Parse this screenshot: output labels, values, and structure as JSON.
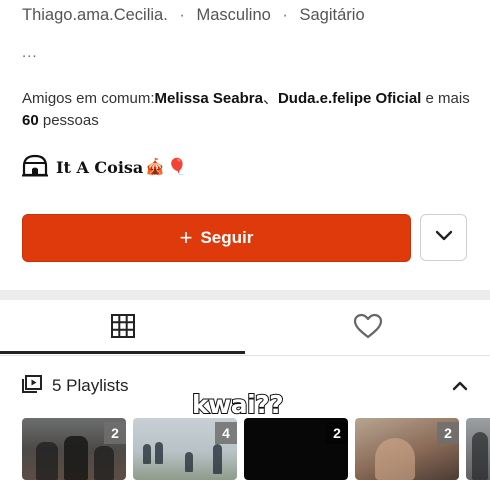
{
  "profile": {
    "username": "Thiago.ama.Cecilia.",
    "gender": "Masculino",
    "zodiac": "Sagitário",
    "separator": "·",
    "ellipsis": "...",
    "mutual": {
      "prefix": "Amigos em comum:",
      "friend1": "Melissa Seabra",
      "joiner": "、",
      "friend2": "Duda.e.felipe Oficial",
      "mid": " e mais ",
      "count": "60",
      "suffix": " pessoas"
    },
    "bio": {
      "text": "It A Coisa",
      "emoji1": "🎪",
      "emoji2": "🎈"
    }
  },
  "actions": {
    "follow_plus": "+",
    "follow_label": "Seguir",
    "more_icon": "chevron-down-icon"
  },
  "tabs": [
    {
      "icon": "grid-icon",
      "active": true
    },
    {
      "icon": "heart-icon",
      "active": false
    }
  ],
  "playlists": {
    "label": "5 Playlists",
    "icon": "playlist-icon",
    "toggle_icon": "chevron-up-icon",
    "items": [
      {
        "count": "2"
      },
      {
        "count": "4"
      },
      {
        "count": "2"
      },
      {
        "count": "2"
      },
      {
        "count": ""
      }
    ]
  },
  "overlay_text": "kwai??",
  "colors": {
    "accent": "#de3a0c",
    "text": "#222222",
    "muted": "#555555"
  }
}
